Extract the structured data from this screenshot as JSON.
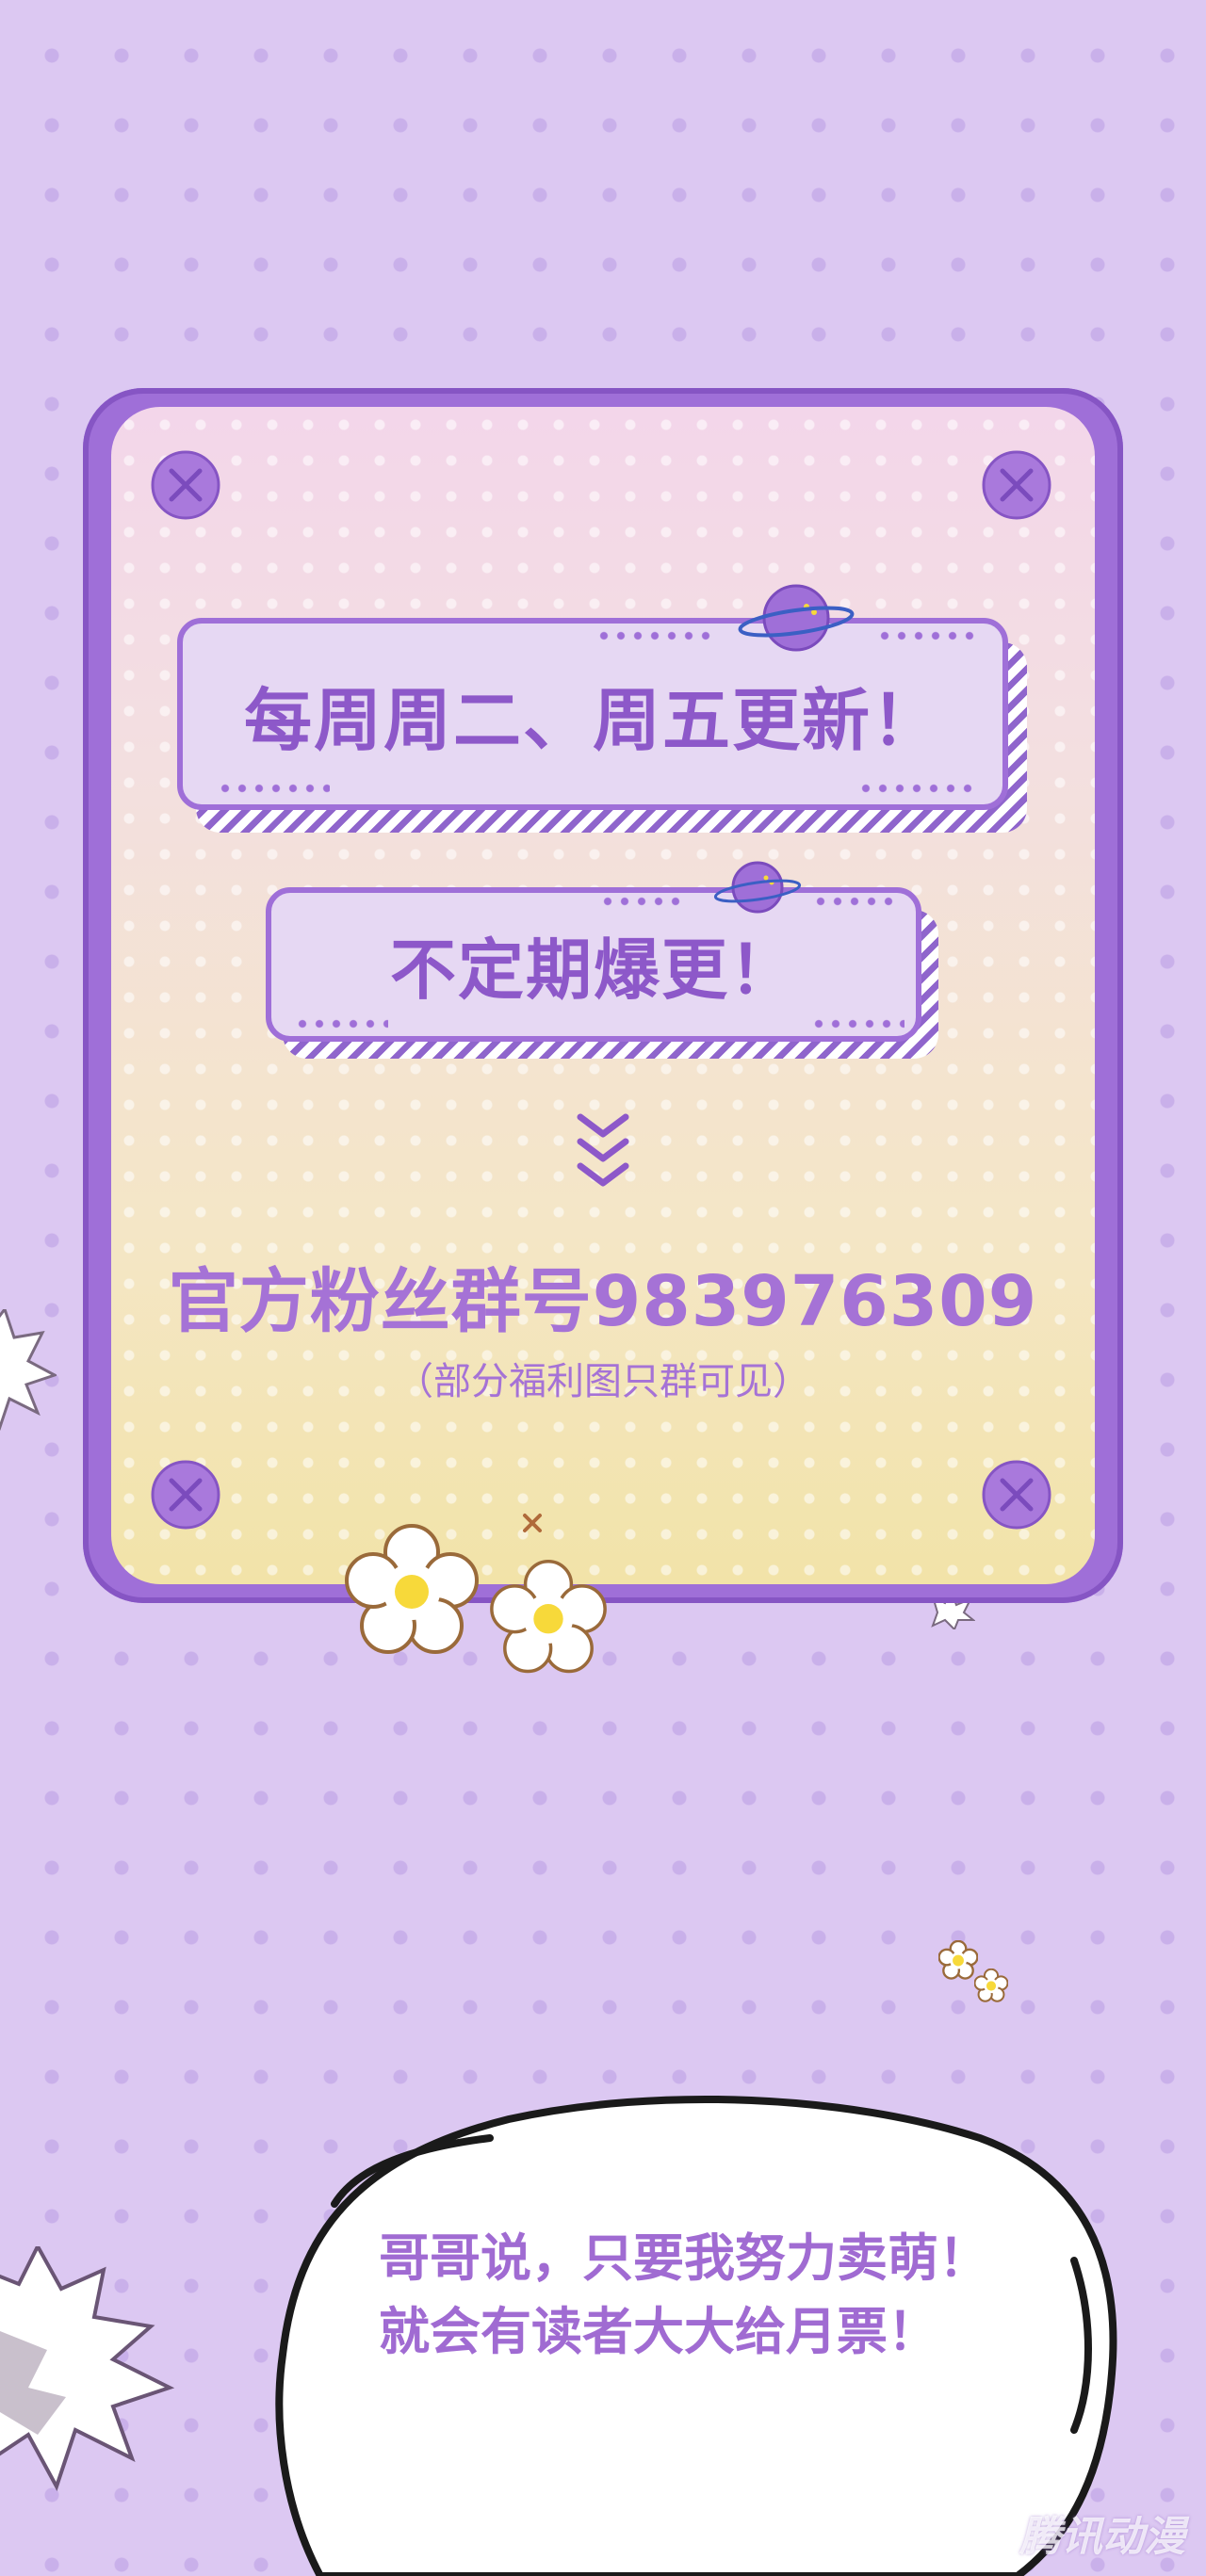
{
  "banner_primary": {
    "text": "每周周二、周五更新！"
  },
  "banner_secondary": {
    "text": "不定期爆更！"
  },
  "fan_group": {
    "text": "官方粉丝群号983976309",
    "note": "（部分福利图只群可见）"
  },
  "speech_bubble": {
    "line1": "哥哥说，只要我努力卖萌！",
    "line2": "就会有读者大大给月票！"
  },
  "watermark": {
    "text": "腾讯动漫"
  },
  "colors": {
    "background": "#dcc8f2",
    "card_border": "#9f6fd8",
    "accent_text": "#8d58c9",
    "flower_center": "#f7d93a"
  },
  "icons": [
    "screw-icon",
    "planet-icon",
    "chevron-down-icon",
    "flower-icon",
    "speech-bubble"
  ]
}
